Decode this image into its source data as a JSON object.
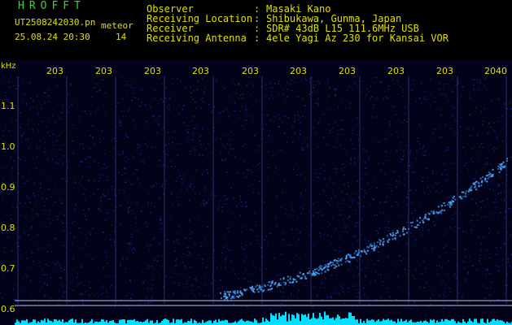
{
  "header": {
    "brand": "HROFFT",
    "file": "UT2508242030.pn",
    "tag": "meteor",
    "timestamp": "25.08.24 20:30",
    "count": "14",
    "rows": [
      {
        "label": "Observer",
        "sep": ":",
        "value": "Masaki Kano"
      },
      {
        "label": "Receiving Location",
        "sep": ":",
        "value": "Shibukawa, Gunma, Japan"
      },
      {
        "label": "Receiver",
        "sep": ":",
        "value": "SDR# 43dB L15 111.6MHz USB"
      },
      {
        "label": "Receiving Antenna",
        "sep": ":",
        "value": "4ele Yagi Az 230 for Kansai VOR"
      }
    ]
  },
  "spectrogram": {
    "unit": "kHz",
    "time_labels": [
      "203",
      "203",
      "203",
      "203",
      "203",
      "203",
      "203",
      "203",
      "203",
      "2040"
    ],
    "freq_labels": [
      "1.1",
      "1.0",
      "0.9",
      "0.8",
      "0.7",
      "0.6"
    ],
    "colors": {
      "background": "#020218",
      "noise": "#1a2a9a",
      "signal": "#4aa8ff",
      "label": "#e0e000",
      "baseline": "#00e0ff"
    }
  }
}
